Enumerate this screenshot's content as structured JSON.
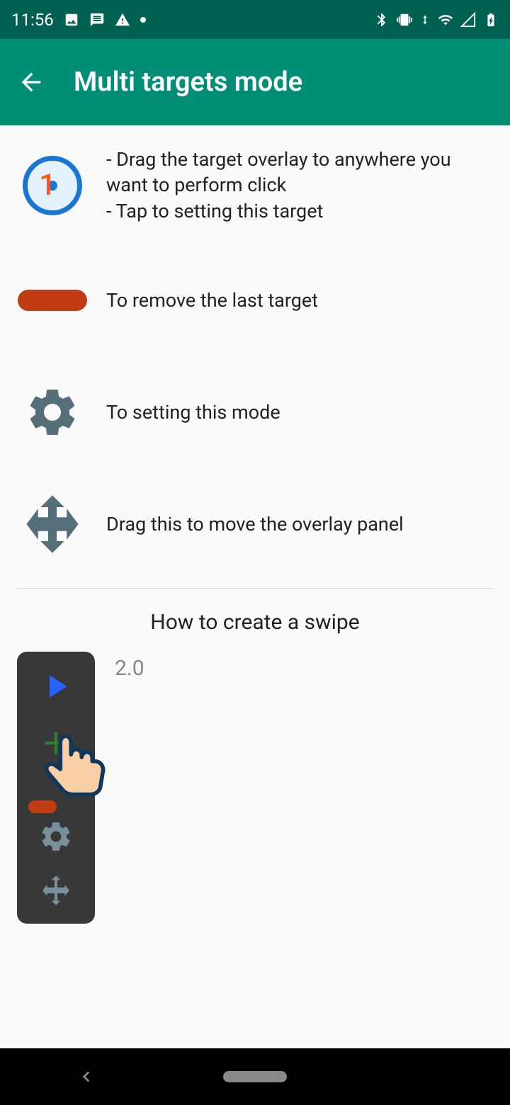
{
  "status": {
    "time": "11:56"
  },
  "header": {
    "title": "Multi targets mode"
  },
  "rows": {
    "target": {
      "number": "1",
      "text": "- Drag the target overlay to anywhere you want to perform click\n- Tap to setting this target"
    },
    "remove": {
      "text": "To remove the last target"
    },
    "settings": {
      "text": "To setting this mode"
    },
    "move": {
      "text": "Drag this to move the overlay panel"
    }
  },
  "swipe": {
    "title": "How to create a swipe",
    "version": "2.0"
  }
}
